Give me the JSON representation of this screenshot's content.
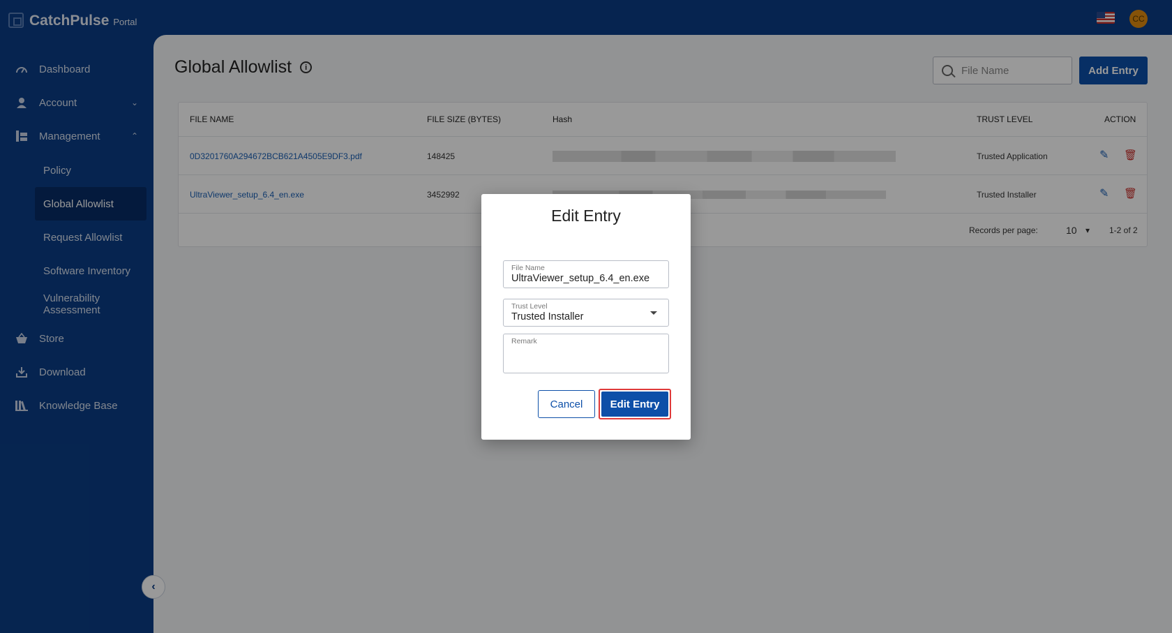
{
  "brand": {
    "name": "CatchPulse",
    "sub": "Portal"
  },
  "header": {
    "avatar_initials": "CC",
    "flag": "us-flag-icon"
  },
  "sidebar": {
    "items": [
      {
        "label": "Dashboard",
        "icon": "gauge-icon"
      },
      {
        "label": "Account",
        "icon": "user-icon"
      },
      {
        "label": "Management",
        "icon": "management-icon"
      },
      {
        "label": "Store",
        "icon": "basket-icon"
      },
      {
        "label": "Download",
        "icon": "download-icon"
      },
      {
        "label": "Knowledge Base",
        "icon": "books-icon"
      }
    ],
    "management_sub": [
      {
        "label": "Policy"
      },
      {
        "label": "Global Allowlist",
        "active": true
      },
      {
        "label": "Request Allowlist"
      },
      {
        "label": "Software Inventory"
      },
      {
        "label": "Vulnerability Assessment"
      }
    ]
  },
  "page": {
    "title": "Global Allowlist",
    "search_placeholder": "File Name",
    "add_button": "Add Entry"
  },
  "table": {
    "headers": {
      "file_name": "FILE NAME",
      "file_size": "FILE SIZE (BYTES)",
      "hash": "Hash",
      "trust_level": "TRUST LEVEL",
      "action": "ACTION"
    },
    "rows": [
      {
        "file_name": "0D3201760A294672BCB621A4505E9DF3.pdf",
        "file_size": "148425",
        "trust_level": "Trusted Application"
      },
      {
        "file_name": "UltraViewer_setup_6.4_en.exe",
        "file_size": "3452992",
        "trust_level": "Trusted Installer"
      }
    ],
    "pagination": {
      "label": "Records per page:",
      "per_page": "10",
      "range": "1-2 of 2"
    }
  },
  "dialog": {
    "title": "Edit Entry",
    "file_name_label": "File Name",
    "file_name_value": "UltraViewer_setup_6.4_en.exe",
    "trust_level_label": "Trust Level",
    "trust_level_value": "Trusted Installer",
    "remark_label": "Remark",
    "cancel_label": "Cancel",
    "submit_label": "Edit Entry"
  },
  "colors": {
    "sidebar": "#0a3d85",
    "primary": "#0d4fa8",
    "highlight": "#e03a3a",
    "avatar": "#e08a10"
  }
}
